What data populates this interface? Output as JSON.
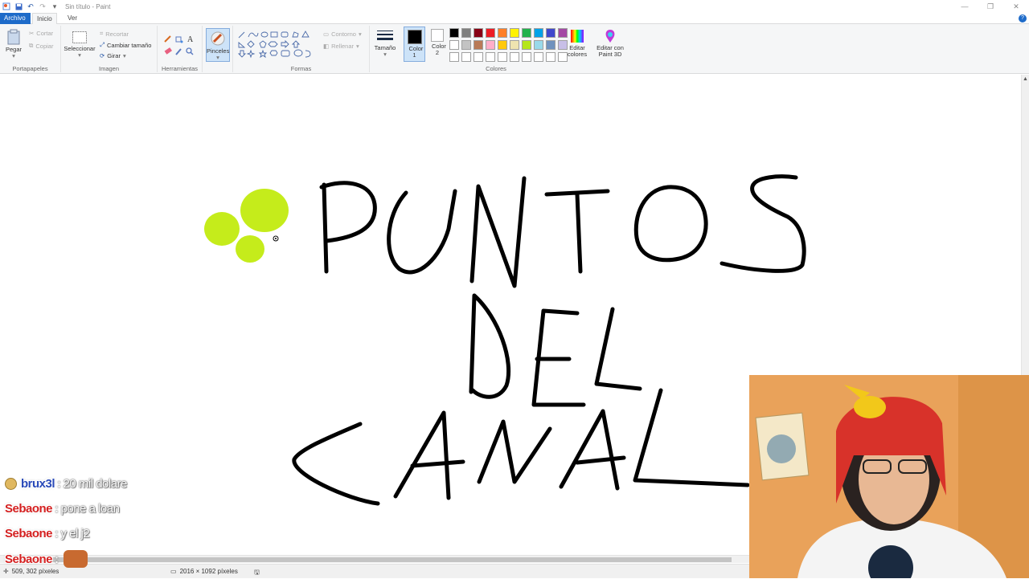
{
  "window": {
    "title": "Sin título - Paint",
    "controls": [
      "—",
      "❐",
      "✕"
    ]
  },
  "tabs": {
    "file": "Archivo",
    "home": "Inicio",
    "view": "Ver",
    "help": "?"
  },
  "ribbon": {
    "clipboard": {
      "paste": "Pegar",
      "cut": "Cortar",
      "copy": "Copiar",
      "label": "Portapapeles"
    },
    "image": {
      "select": "Seleccionar",
      "crop": "Recortar",
      "resize": "Cambiar tamaño",
      "rotate": "Girar",
      "label": "Imagen"
    },
    "tools": {
      "label": "Herramientas"
    },
    "brushes": {
      "label": "Pinceles"
    },
    "shapes": {
      "outline": "Contorno",
      "fill": "Rellenar",
      "label": "Formas"
    },
    "size": {
      "label": "Tamaño"
    },
    "color1": {
      "label": "Color 1",
      "value": "#000000"
    },
    "color2": {
      "label": "Color 2",
      "value": "#ffffff"
    },
    "colors": {
      "label": "Colores",
      "palette": [
        "#000000",
        "#7f7f7f",
        "#880015",
        "#ed1c24",
        "#ff7f27",
        "#fff200",
        "#22b14c",
        "#00a2e8",
        "#3f48cc",
        "#a349a4",
        "#ffffff",
        "#c3c3c3",
        "#b97a57",
        "#ffaec9",
        "#ffc90e",
        "#efe4b0",
        "#b5e61d",
        "#99d9ea",
        "#7092be",
        "#c8bfe7",
        "#ffffff",
        "#ffffff",
        "#ffffff",
        "#ffffff",
        "#ffffff",
        "#ffffff",
        "#ffffff",
        "#ffffff",
        "#ffffff",
        "#ffffff"
      ]
    },
    "edit_colors": "Editar colores",
    "paint3d": "Editar con Paint 3D"
  },
  "canvas": {
    "dot_color": "#c5ec1b"
  },
  "chat": [
    {
      "user": "brux3l",
      "message": "20 mil dolare",
      "user_color": "blue",
      "badge": true
    },
    {
      "user": "Sebaone",
      "message": "pone a loan",
      "user_color": "red"
    },
    {
      "user": "Sebaone",
      "message": "y el j2",
      "user_color": "red"
    },
    {
      "user": "Sebaone",
      "message": "",
      "user_color": "red",
      "emote": true
    }
  ],
  "status": {
    "cursor": "509, 302 píxeles",
    "size": "2016 × 1092 píxeles"
  }
}
